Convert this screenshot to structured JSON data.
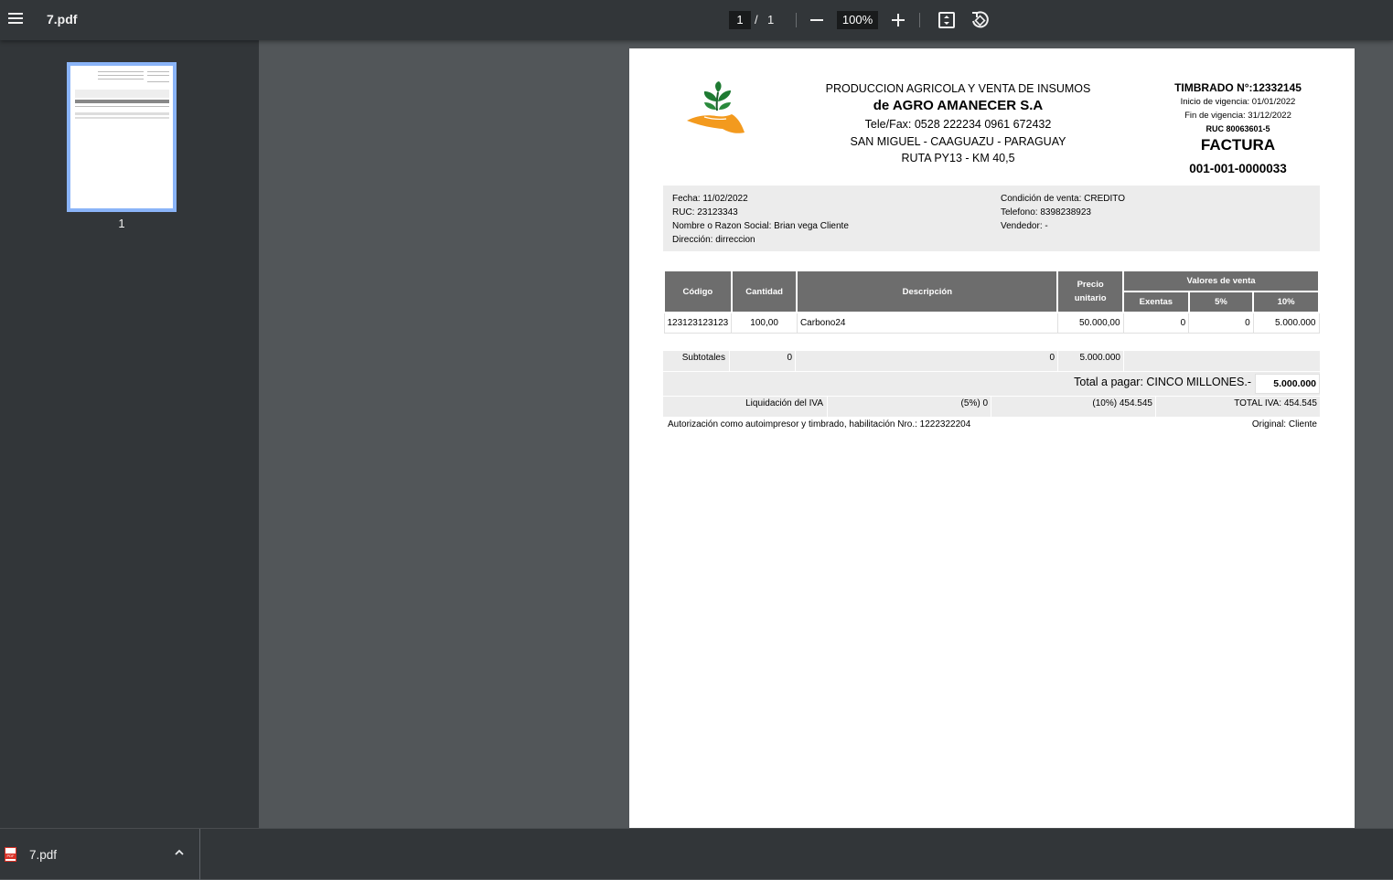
{
  "viewer": {
    "file_name": "7.pdf",
    "current_page": "1",
    "page_separator": "/",
    "total_pages": "1",
    "zoom": "100%",
    "thumbnail_label": "1"
  },
  "download_bar": {
    "file_name": "7.pdf"
  },
  "invoice": {
    "company_line1": "PRODUCCION AGRICOLA Y VENTA DE INSUMOS",
    "company_name": "de AGRO AMANECER S.A",
    "phone": "Tele/Fax: 0528 222234 0961 672432",
    "location": "SAN MIGUEL - CAAGUAZU - PARAGUAY",
    "route": "RUTA PY13 - KM 40,5",
    "timbrado": "TIMBRADO N°:12332145",
    "vigencia_inicio": "Inicio de vigencia: 01/01/2022",
    "vigencia_fin": "Fin de vigencia: 31/12/2022",
    "ruc_emisor": "RUC 80063601-5",
    "doc_type": "FACTURA",
    "doc_number": "001-001-0000033",
    "client": {
      "fecha": "Fecha: 11/02/2022",
      "ruc": "RUC: 23123343",
      "nombre": "Nombre o Razon Social: Brian vega Cliente",
      "direccion": "Dirección: dirreccion",
      "condicion": "Condición de venta: CREDITO",
      "telefono": "Telefono: 8398238923",
      "vendedor": "Vendedor: -"
    },
    "table": {
      "h_codigo": "Código",
      "h_cantidad": "Cantidad",
      "h_descripcion": "Descripción",
      "h_precio": "Precio unitario",
      "h_valores": "Valores de venta",
      "h_exentas": "Exentas",
      "h_5": "5%",
      "h_10": "10%",
      "rows": [
        {
          "codigo": "123123123123",
          "cantidad": "100,00",
          "descripcion": "Carbono24",
          "precio": "50.000,00",
          "exentas": "0",
          "cinco": "0",
          "diez": "5.000.000"
        }
      ]
    },
    "subtotales_label": "Subtotales",
    "subtotal_exentas": "0",
    "subtotal_5": "0",
    "subtotal_10": "5.000.000",
    "total_label": "Total a pagar: CINCO MILLONES.-",
    "total_value": "5.000.000",
    "iva_label": "Liquidación del IVA",
    "iva_5": "(5%) 0",
    "iva_10": "(10%) 454.545",
    "iva_total": "TOTAL IVA: 454.545",
    "autorizacion": "Autorización como autoimpresor y timbrado, habilitación Nro.: 1222322204",
    "original": "Original: Cliente"
  }
}
